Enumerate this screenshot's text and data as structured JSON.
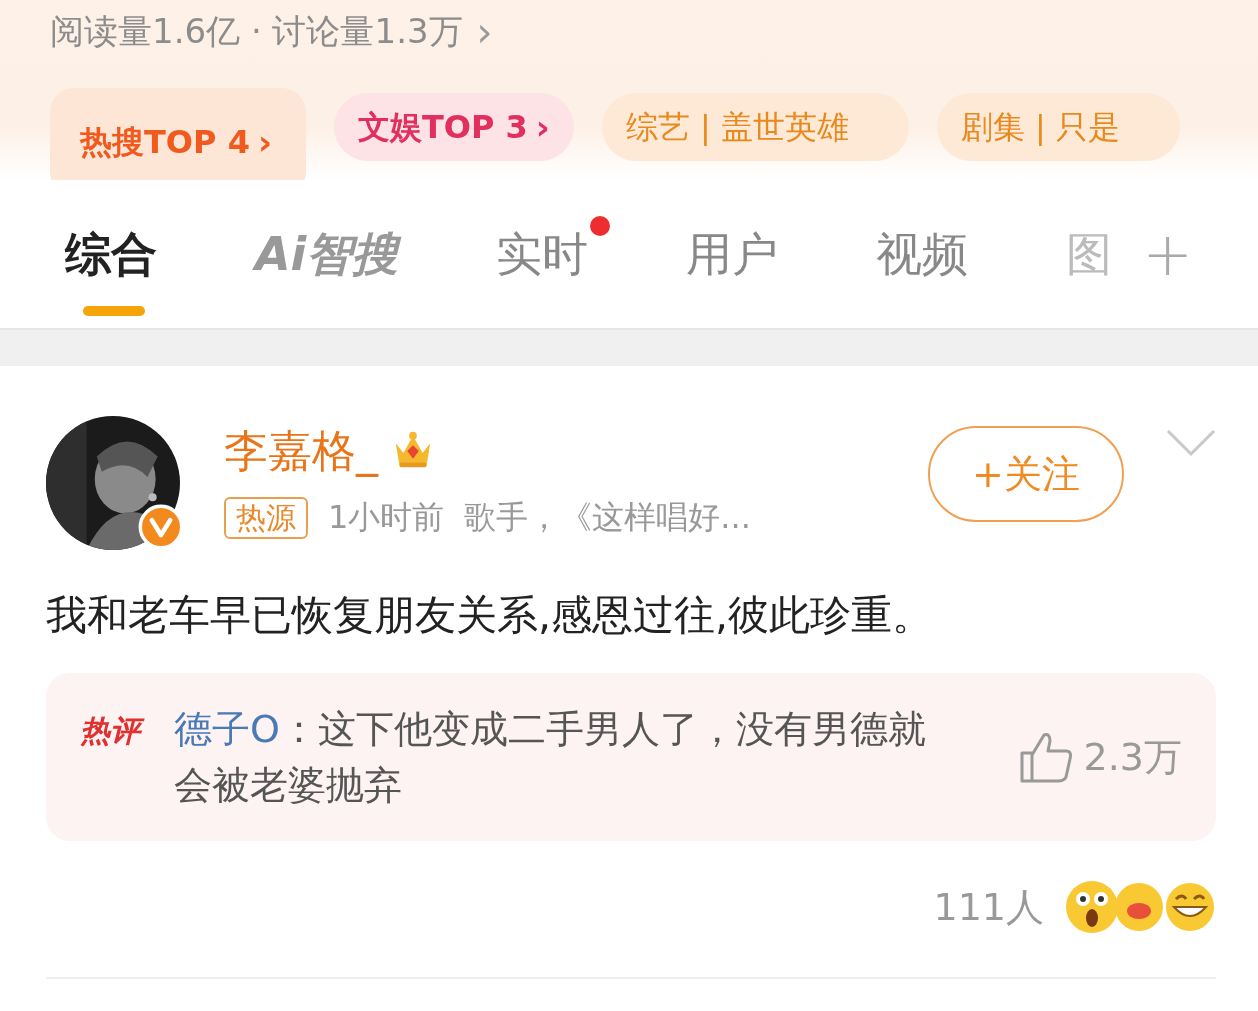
{
  "topic": {
    "stats": "阅读量1.6亿 · 讨论量1.3万",
    "arrow": "›"
  },
  "chips": [
    {
      "kind": "hot",
      "label": "热搜TOP 4",
      "arrow": "›"
    },
    {
      "kind": "ent",
      "label": "文娱TOP 3",
      "arrow": "›"
    },
    {
      "kind": "topic",
      "label": "综艺 | 盖世英雄"
    },
    {
      "kind": "topic",
      "label": "剧集 | 只是"
    }
  ],
  "tabs": [
    {
      "label": "综合",
      "kind": "text",
      "selected": true,
      "dot": false
    },
    {
      "label": "Ai智搜",
      "kind": "ai",
      "selected": false,
      "dot": false
    },
    {
      "label": "实时",
      "kind": "text",
      "selected": false,
      "dot": true
    },
    {
      "label": "用户",
      "kind": "text",
      "selected": false,
      "dot": false
    },
    {
      "label": "视频",
      "kind": "text",
      "selected": false,
      "dot": false
    },
    {
      "label": "图",
      "kind": "cut",
      "selected": false,
      "dot": false
    }
  ],
  "tab_add": "+",
  "post": {
    "author": "李嘉格_",
    "verified": true,
    "tag": "热源",
    "time": "1小时前",
    "bio": "歌手，《这样唱好...",
    "follow": "+关注",
    "text": "我和老车早已恢复朋友关系,感恩过往,彼此珍重。",
    "hot_comment": {
      "badge": "热评",
      "user": "德子O",
      "text": "：这下他变成二手男人了，没有男德就会被老婆抛弃",
      "likes": "2.3万"
    },
    "reactions": {
      "count": "111人"
    }
  }
}
